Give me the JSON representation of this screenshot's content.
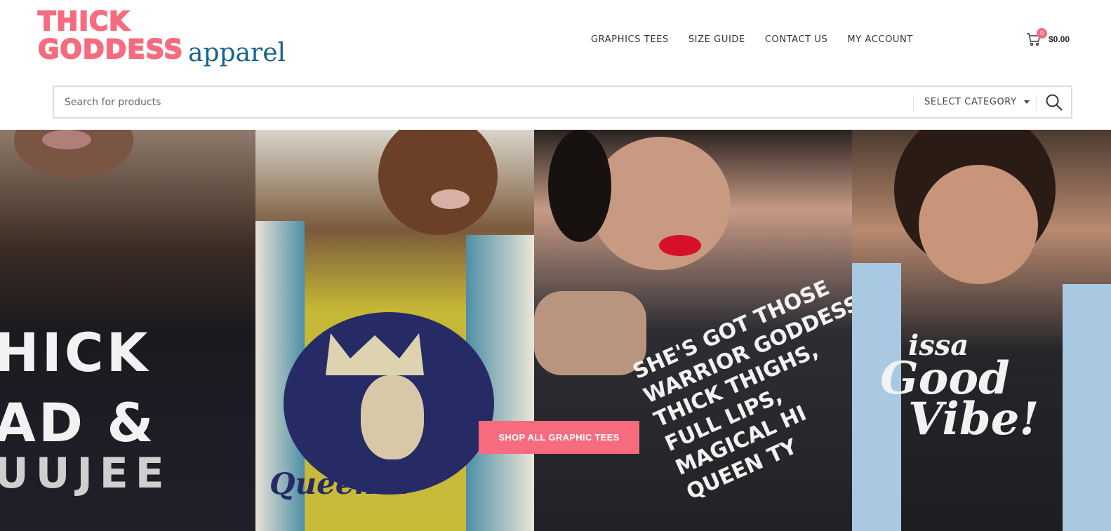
{
  "logo": {
    "line1": "THICK",
    "line2": "GODDESS",
    "suffix": "apparel",
    "colors": {
      "bubble": "#f76b7e",
      "apparel": "#17638c"
    }
  },
  "nav": {
    "items": [
      {
        "label": "GRAPHICS TEES"
      },
      {
        "label": "SIZE GUIDE"
      },
      {
        "label": "CONTACT US"
      },
      {
        "label": "MY ACCOUNT"
      }
    ]
  },
  "cart": {
    "count": "0",
    "total": "$0.00",
    "icon": "cart-icon"
  },
  "search": {
    "placeholder": "Search for products",
    "category_label": "SELECT CATEGORY",
    "button_icon": "search-icon"
  },
  "hero": {
    "cta_label": "SHOP ALL GRAPHIC TEES",
    "cta_color": "#f76b7e",
    "panels": [
      {
        "shirt_lines": [
          "HICK",
          "AD &",
          "UUJEE"
        ]
      },
      {
        "shirt_word": "Queenin'"
      },
      {
        "shirt_lines": [
          "SHE'S GOT THOSE",
          "WARRIOR GODDESS,",
          "THICK THIGHS,",
          "FULL LIPS,",
          "MAGICAL HI",
          "QUEEN TY"
        ]
      },
      {
        "shirt_lines": [
          "issa",
          "Good",
          "Vibe!"
        ]
      }
    ]
  }
}
